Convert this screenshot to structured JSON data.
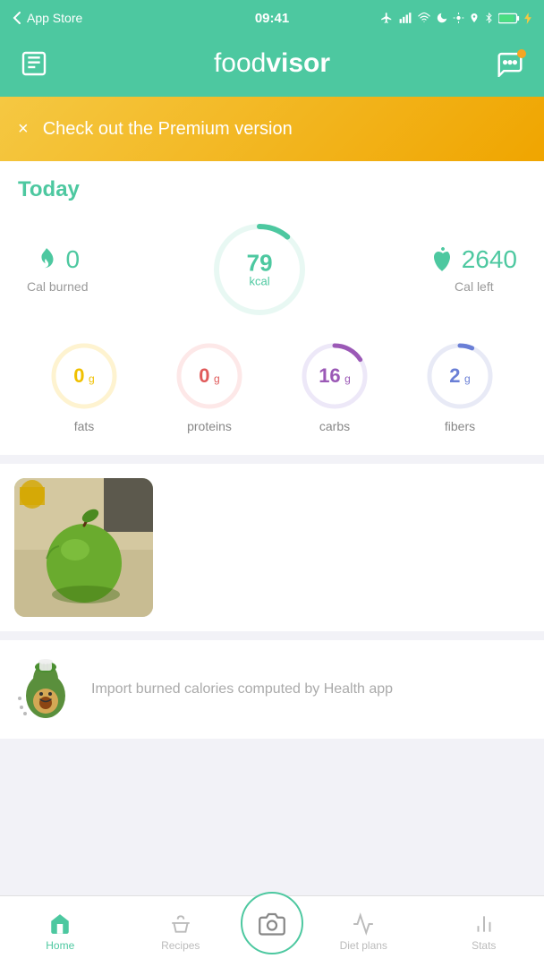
{
  "statusBar": {
    "carrier": "App Store",
    "time": "09:41",
    "icons": [
      "airplane",
      "signal",
      "wifi",
      "moon",
      "lock-rotation",
      "location",
      "bluetooth",
      "battery"
    ]
  },
  "header": {
    "logoFirst": "food",
    "logoSecond": "visor",
    "leftIcon": "newspaper-icon",
    "rightIcon": "chat-icon"
  },
  "premiumBanner": {
    "closeLabel": "×",
    "text": "Check out the Premium version"
  },
  "today": {
    "label": "Today",
    "calBurned": {
      "value": "0",
      "label": "Cal burned"
    },
    "kcalCircle": {
      "value": "79",
      "unit": "kcal"
    },
    "calLeft": {
      "value": "2640",
      "label": "Cal left"
    }
  },
  "macros": {
    "fats": {
      "value": "0",
      "unit": "g",
      "label": "fats"
    },
    "proteins": {
      "value": "0",
      "unit": "g",
      "label": "proteins"
    },
    "carbs": {
      "value": "16",
      "unit": "g",
      "label": "carbs"
    },
    "fibers": {
      "value": "2",
      "unit": "g",
      "label": "fibers"
    }
  },
  "importSection": {
    "text": "Import burned calories computed by Health app"
  },
  "nav": {
    "items": [
      {
        "label": "Home",
        "icon": "home",
        "active": true
      },
      {
        "label": "Recipes",
        "icon": "bowl",
        "active": false
      },
      {
        "label": "",
        "icon": "camera",
        "active": false,
        "isCamera": true
      },
      {
        "label": "Diet plans",
        "icon": "heartbeat",
        "active": false
      },
      {
        "label": "Stats",
        "icon": "barchart",
        "active": false
      }
    ]
  }
}
